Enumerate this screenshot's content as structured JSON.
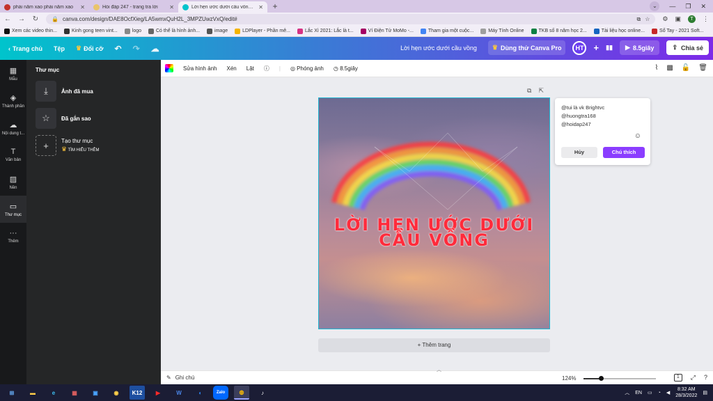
{
  "browser": {
    "tabs": [
      {
        "label": "phải năm xao phải năm xao",
        "favicon_color": "#c4302b",
        "active": false
      },
      {
        "label": "Hỏi đáp 247 - trang tra lời",
        "favicon_color": "#e9c46a",
        "active": false
      },
      {
        "label": "Lời hẹn ước dưới cầu vồng - Log",
        "favicon_color": "#00c4cc",
        "active": true
      }
    ],
    "url": "canva.com/design/DAE8OcfXieg/LA5wmxQuH2L_3MPZUwzVxQ/edit#",
    "bookmarks": [
      {
        "label": "Xem các video thin...",
        "color": "#111111"
      },
      {
        "label": "Kinh gong teen vint...",
        "color": "#333333"
      },
      {
        "label": "logo",
        "color": "#888888"
      },
      {
        "label": "Có thể là hình ảnh...",
        "color": "#666666"
      },
      {
        "label": "image",
        "color": "#555555"
      },
      {
        "label": "LDPlayer - Phần mê...",
        "color": "#f4b400"
      },
      {
        "label": "Lắc Xì 2021: Lắc là t...",
        "color": "#d63384"
      },
      {
        "label": "Ví Điện Tử MoMo -...",
        "color": "#a50064"
      },
      {
        "label": "Tham gia một cuộc...",
        "color": "#4285f4"
      },
      {
        "label": "Máy Tính Online",
        "color": "#9e9e9e"
      },
      {
        "label": "TKB số 8 năm học 2...",
        "color": "#0b8043"
      },
      {
        "label": "Tài liệu học online...",
        "color": "#1565c0"
      },
      {
        "label": "Sổ Tay - 2021 Soft...",
        "color": "#c62828"
      }
    ],
    "profile_initial": "T"
  },
  "header": {
    "home": "Trang chủ",
    "file": "Tệp",
    "resize": "Đổi cỡ",
    "design_title": "Lời hẹn ước dưới cầu vồng",
    "try_pro": "Dùng thử Canva Pro",
    "avatar": "HT",
    "play": "8.5giây",
    "share": "Chia sẻ"
  },
  "rail": {
    "items": [
      {
        "label": "Mẫu",
        "icon": "template-icon"
      },
      {
        "label": "Thành phần",
        "icon": "elements-icon"
      },
      {
        "label": "Nội dung t...",
        "icon": "upload-icon"
      },
      {
        "label": "Văn bản",
        "icon": "text-icon"
      },
      {
        "label": "Nền",
        "icon": "background-icon"
      },
      {
        "label": "Thư mục",
        "icon": "folder-icon"
      },
      {
        "label": "Thêm",
        "icon": "more-icon"
      }
    ]
  },
  "panel": {
    "title": "Thư mục",
    "folders": [
      {
        "label": "Ảnh đã mua"
      },
      {
        "label": "Đã gắn sao"
      },
      {
        "label": "Tạo thư mục"
      }
    ],
    "learn_more": "TÌM HIỂU THÊM"
  },
  "toolbar": {
    "edit_image": "Sửa hình ảnh",
    "crop": "Xén",
    "flip": "Lật",
    "animate": "Phóng ảnh",
    "duration": "8.5giây"
  },
  "design": {
    "line1": "LỜI HẸN ƯỚC DƯỚI",
    "line2": "CẦU VỒNG",
    "add_page": "+ Thêm trang"
  },
  "comment": {
    "lines": [
      "@tui là vk Brightvc",
      "@huongtra168",
      "@hoidap247"
    ],
    "cancel": "Hủy",
    "submit": "Chú thích"
  },
  "bottom": {
    "notes": "Ghi chú",
    "zoom": "124%",
    "zoom_fraction": 0.24,
    "page_count": "1"
  },
  "taskbar": {
    "lang": "EN",
    "time": "8:32 AM",
    "date": "28/3/2022"
  }
}
